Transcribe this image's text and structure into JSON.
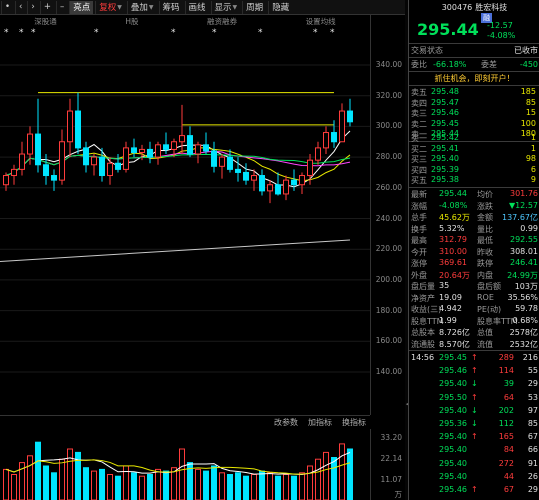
{
  "toolbar": {
    "nav_left": "‹",
    "nav_right": "›",
    "items": [
      "亮点",
      "复权",
      "叠加",
      "筹码",
      "画线",
      "显示",
      "周期",
      "隐藏"
    ],
    "minus": "–",
    "plus": "+",
    "dot": "•"
  },
  "chart": {
    "legend": [
      "深股通",
      "H股",
      "融资融券",
      "设置均线"
    ],
    "volume_header": [
      "改参数",
      "加指标",
      "换指标"
    ],
    "price_axis": [
      "340.00",
      "320.00",
      "300.00",
      "280.00",
      "260.00",
      "240.00",
      "220.00",
      "200.00",
      "180.00",
      "160.00",
      "140.00"
    ],
    "volume_axis": [
      "33.20",
      "22.14",
      "11.07",
      "万"
    ],
    "colors": {
      "up": "#ff3c3c",
      "down": "#00e5ff",
      "ma5": "#ffffff",
      "ma10": "#e8e800",
      "ma20": "#ff44ff",
      "ma60": "#00e05a",
      "ma250": "#c8c8c8",
      "resistance": "#e8e800"
    }
  },
  "chart_data": {
    "type": "candlestick",
    "ylim": [
      190,
      340
    ],
    "volume_ylim": [
      0,
      40
    ],
    "candles": [
      [
        262,
        270,
        258,
        268
      ],
      [
        268,
        275,
        262,
        272
      ],
      [
        272,
        290,
        268,
        282
      ],
      [
        282,
        300,
        275,
        295
      ],
      [
        295,
        318,
        270,
        275
      ],
      [
        275,
        282,
        262,
        268
      ],
      [
        268,
        272,
        258,
        265
      ],
      [
        265,
        298,
        262,
        290
      ],
      [
        290,
        318,
        280,
        310
      ],
      [
        310,
        322,
        282,
        286
      ],
      [
        286,
        290,
        270,
        275
      ],
      [
        275,
        282,
        268,
        280
      ],
      [
        280,
        286,
        264,
        268
      ],
      [
        268,
        280,
        262,
        276
      ],
      [
        276,
        282,
        270,
        272
      ],
      [
        272,
        290,
        270,
        286
      ],
      [
        286,
        292,
        280,
        283
      ],
      [
        283,
        288,
        278,
        285
      ],
      [
        285,
        290,
        276,
        280
      ],
      [
        280,
        290,
        275,
        288
      ],
      [
        288,
        296,
        282,
        285
      ],
      [
        285,
        292,
        280,
        290
      ],
      [
        290,
        314,
        282,
        294
      ],
      [
        294,
        300,
        280,
        282
      ],
      [
        282,
        290,
        276,
        288
      ],
      [
        288,
        296,
        282,
        284
      ],
      [
        284,
        290,
        270,
        274
      ],
      [
        274,
        282,
        266,
        280
      ],
      [
        280,
        285,
        270,
        272
      ],
      [
        272,
        280,
        264,
        270
      ],
      [
        270,
        276,
        262,
        265
      ],
      [
        265,
        272,
        258,
        268
      ],
      [
        268,
        272,
        255,
        258
      ],
      [
        258,
        265,
        250,
        262
      ],
      [
        262,
        270,
        255,
        256
      ],
      [
        256,
        268,
        252,
        265
      ],
      [
        265,
        272,
        258,
        262
      ],
      [
        262,
        270,
        256,
        268
      ],
      [
        268,
        282,
        262,
        278
      ],
      [
        278,
        290,
        275,
        286
      ],
      [
        286,
        300,
        282,
        296
      ],
      [
        296,
        304,
        286,
        290
      ],
      [
        290,
        315,
        290,
        310
      ],
      [
        310,
        318,
        300,
        303
      ]
    ],
    "volumes": [
      18,
      15,
      22,
      26,
      34,
      20,
      16,
      24,
      30,
      28,
      19,
      17,
      18,
      15,
      14,
      20,
      16,
      14,
      15,
      18,
      17,
      19,
      30,
      22,
      18,
      17,
      20,
      16,
      15,
      16,
      14,
      15,
      17,
      16,
      14,
      15,
      14,
      16,
      20,
      24,
      28,
      25,
      33,
      30
    ],
    "resistance_lines": [
      322,
      301
    ],
    "ma250": [
      [
        0,
        212
      ],
      [
        44,
        226
      ]
    ]
  },
  "stock": {
    "code": "300476",
    "name": "胜宏科技",
    "tag": "融",
    "price": "295.44",
    "change": "-12.57",
    "pct": "-4.08%",
    "status_label": "交易状态",
    "status_value": "已收市",
    "weibi_label": "委比",
    "weibi_value": "-66.18%",
    "weicha_label": "委差",
    "weicha_value": "-450",
    "promo": "抓住机会，即刻开户！"
  },
  "sells": [
    {
      "label": "卖五",
      "price": "295.48",
      "vol": "185"
    },
    {
      "label": "卖四",
      "price": "295.47",
      "vol": "85"
    },
    {
      "label": "卖三",
      "price": "295.46",
      "vol": "15"
    },
    {
      "label": "卖二",
      "price": "295.45",
      "vol": "100"
    },
    {
      "label": "卖一",
      "price": "295.44",
      "vol": "180"
    }
  ],
  "buys": [
    {
      "label": "买一",
      "price": "295.42",
      "vol": "1"
    },
    {
      "label": "买二",
      "price": "295.41",
      "vol": "1"
    },
    {
      "label": "买三",
      "price": "295.40",
      "vol": "98"
    },
    {
      "label": "买四",
      "price": "295.39",
      "vol": "6"
    },
    {
      "label": "买五",
      "price": "295.38",
      "vol": "9"
    }
  ],
  "quotes": [
    {
      "l1": "最新",
      "v1": "295.44",
      "c1": "green",
      "l2": "均价",
      "v2": "301.76",
      "c2": "red"
    },
    {
      "l1": "涨幅",
      "v1": "-4.08%",
      "c1": "green",
      "l2": "涨跌",
      "v2": "▼12.57",
      "c2": "green"
    },
    {
      "l1": "总手",
      "v1": "45.62万",
      "c1": "yellow",
      "l2": "金额",
      "v2": "137.67亿",
      "c2": "cyan"
    },
    {
      "l1": "换手",
      "v1": "5.32%",
      "c1": "white",
      "l2": "量比",
      "v2": "0.99",
      "c2": "white"
    },
    {
      "l1": "最高",
      "v1": "312.79",
      "c1": "red",
      "l2": "最低",
      "v2": "292.55",
      "c2": "green"
    },
    {
      "l1": "今开",
      "v1": "310.00",
      "c1": "red",
      "l2": "昨收",
      "v2": "308.01",
      "c2": "white"
    },
    {
      "l1": "涨停",
      "v1": "369.61",
      "c1": "red",
      "l2": "跌停",
      "v2": "246.41",
      "c2": "green"
    },
    {
      "l1": "外盘",
      "v1": "20.64万",
      "c1": "red",
      "l2": "内盘",
      "v2": "24.99万",
      "c2": "green"
    },
    {
      "l1": "盘后量",
      "v1": "35",
      "c1": "white",
      "l2": "盘后额",
      "v2": "103万",
      "c2": "white"
    },
    {
      "l1": "净资产",
      "v1": "19.09",
      "c1": "white",
      "l2": "ROE",
      "v2": "35.56%",
      "c2": "white"
    },
    {
      "l1": "收益(三)",
      "v1": "4.942",
      "c1": "white",
      "l2": "PE(动)",
      "v2": "59.78",
      "c2": "white"
    },
    {
      "l1": "股息TTM",
      "v1": "1.99",
      "c1": "white",
      "l2": "股息率TTM",
      "v2": "0.68%",
      "c2": "white"
    },
    {
      "l1": "总股本",
      "v1": "8.726亿",
      "c1": "white",
      "l2": "总值",
      "v2": "2578亿",
      "c2": "white"
    },
    {
      "l1": "流通股",
      "v1": "8.570亿",
      "c1": "white",
      "l2": "流值",
      "v2": "2532亿",
      "c2": "white"
    }
  ],
  "ticks": [
    {
      "time": "14:56",
      "price": "295.45",
      "arrow": "↑",
      "dir": "up",
      "vol": "289",
      "n": "216"
    },
    {
      "time": "",
      "price": "295.46",
      "arrow": "↑",
      "dir": "up",
      "vol": "114",
      "n": "55"
    },
    {
      "time": "",
      "price": "295.40",
      "arrow": "↓",
      "dir": "down",
      "vol": "39",
      "n": "29"
    },
    {
      "time": "",
      "price": "295.50",
      "arrow": "↑",
      "dir": "up",
      "vol": "64",
      "n": "53"
    },
    {
      "time": "",
      "price": "295.40",
      "arrow": "↓",
      "dir": "down",
      "vol": "202",
      "n": "97"
    },
    {
      "time": "",
      "price": "295.36",
      "arrow": "↓",
      "dir": "down",
      "vol": "112",
      "n": "85"
    },
    {
      "time": "",
      "price": "295.40",
      "arrow": "↑",
      "dir": "up",
      "vol": "165",
      "n": "67"
    },
    {
      "time": "",
      "price": "295.40",
      "arrow": "",
      "dir": "flat",
      "vol": "84",
      "n": "66"
    },
    {
      "time": "",
      "price": "295.40",
      "arrow": "",
      "dir": "flat",
      "vol": "272",
      "n": "91"
    },
    {
      "time": "",
      "price": "295.40",
      "arrow": "",
      "dir": "flat",
      "vol": "44",
      "n": "26"
    },
    {
      "time": "",
      "price": "295.46",
      "arrow": "↑",
      "dir": "up",
      "vol": "67",
      "n": "29"
    }
  ]
}
